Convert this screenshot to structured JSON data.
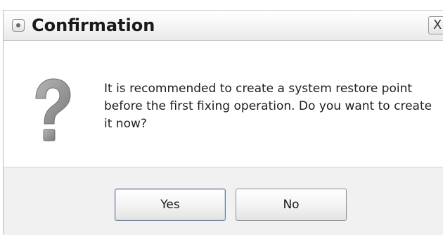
{
  "dialog": {
    "title": "Confirmation",
    "close_label": "X",
    "message": "It is recommended to create a system restore point before the first fixing operation. Do you want to create it now?",
    "icon": "question-mark-icon"
  },
  "buttons": {
    "yes_label": "Yes",
    "no_label": "No"
  },
  "colors": {
    "footer_bg": "#f1f1f1",
    "icon_gray": "#8c8c8c",
    "text": "#1e1e1e"
  }
}
